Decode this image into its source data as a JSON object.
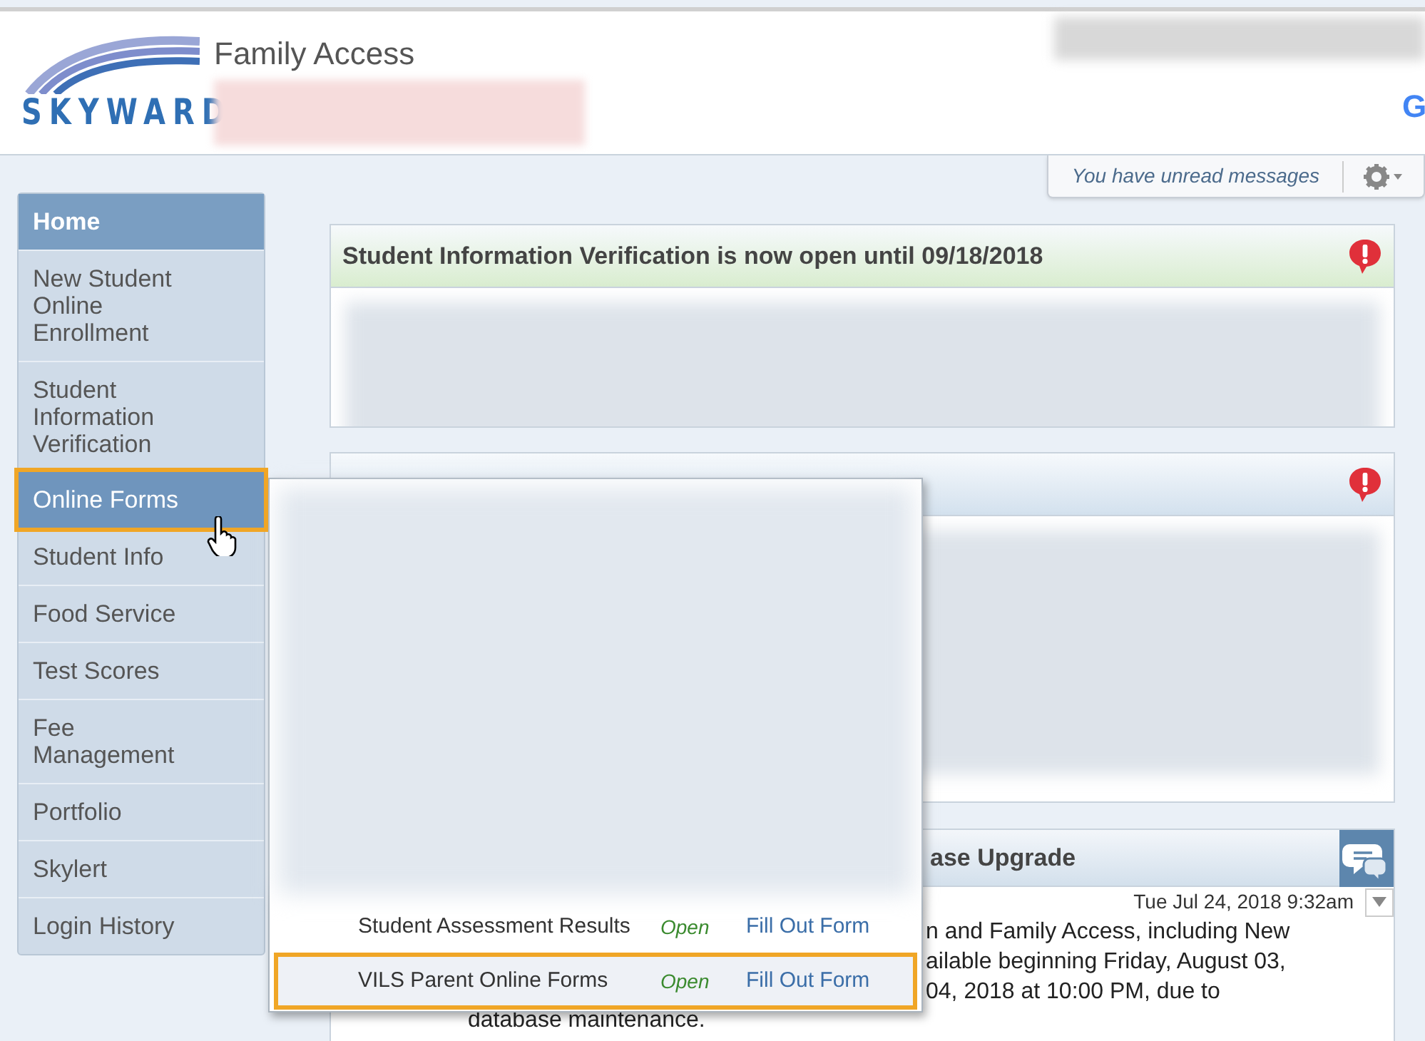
{
  "header": {
    "logo_text": "SKYWARD",
    "title": "Family Access",
    "extension_badge": "G"
  },
  "toolbar": {
    "messages": "You have unread messages"
  },
  "sidebar": {
    "items": [
      {
        "label": "Home",
        "selected": true,
        "highlighted": false
      },
      {
        "label": "New Student Online Enrollment",
        "selected": false,
        "highlighted": false
      },
      {
        "label": "Student Information Verification",
        "selected": false,
        "highlighted": false
      },
      {
        "label": "Online Forms",
        "selected": false,
        "highlighted": true
      },
      {
        "label": "Student Info",
        "selected": false,
        "highlighted": false
      },
      {
        "label": "Food Service",
        "selected": false,
        "highlighted": false
      },
      {
        "label": "Test Scores",
        "selected": false,
        "highlighted": false
      },
      {
        "label": "Fee Management",
        "selected": false,
        "highlighted": false
      },
      {
        "label": "Portfolio",
        "selected": false,
        "highlighted": false
      },
      {
        "label": "Skylert",
        "selected": false,
        "highlighted": false
      },
      {
        "label": "Login History",
        "selected": false,
        "highlighted": false
      }
    ]
  },
  "cards": [
    {
      "kind": "alert",
      "title": "Student Information Verification is now open until 09/18/2018",
      "color": "#d9edcf"
    },
    {
      "kind": "alert",
      "color": "#d3e1ee"
    },
    {
      "kind": "message",
      "title": "ase Upgrade",
      "date": "Tue Jul 24, 2018 9:32am",
      "lines": [
        "n and Family Access, including New",
        "ailable beginning Friday, August 03,",
        "04, 2018 at 10:00 PM, due to"
      ],
      "last_line": "database maintenance."
    }
  ],
  "forms_popup": {
    "rows": [
      {
        "name": "Student Assessment Results",
        "status": "Open",
        "action": "Fill Out Form",
        "highlighted": false
      },
      {
        "name": "VILS Parent Online Forms",
        "status": "Open",
        "action": "Fill Out Form",
        "highlighted": true
      }
    ]
  }
}
